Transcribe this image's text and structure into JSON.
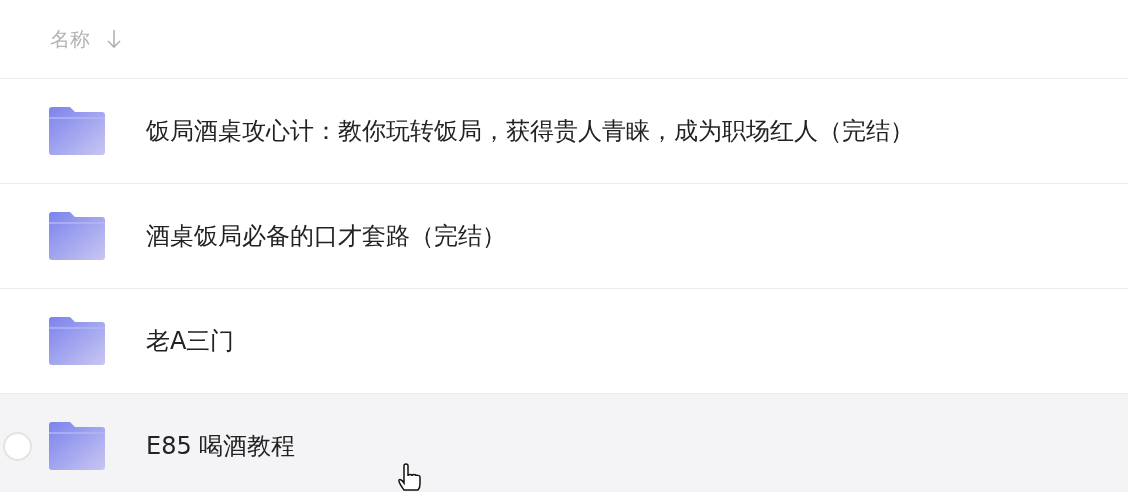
{
  "header": {
    "label": "名称",
    "descending": true
  },
  "rows": [
    {
      "name": "饭局酒桌攻心计：教你玩转饭局，获得贵人青睐，成为职场红人（完结）",
      "hovered": false
    },
    {
      "name": "酒桌饭局必备的口才套路（完结）",
      "hovered": false
    },
    {
      "name": "老A三门",
      "hovered": false
    },
    {
      "name": "E85 喝酒教程",
      "hovered": true
    }
  ]
}
